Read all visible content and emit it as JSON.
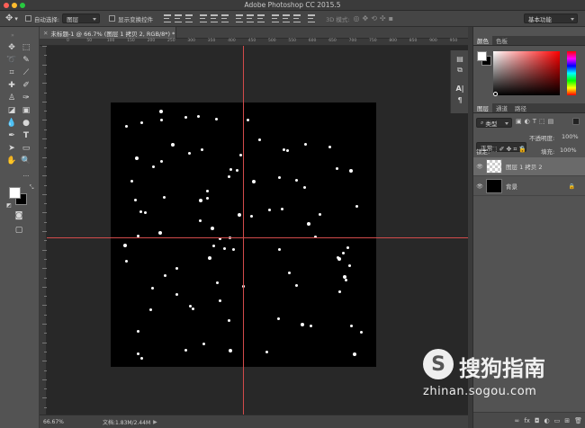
{
  "window": {
    "title": "Adobe Photoshop CC 2015.5"
  },
  "options_bar": {
    "auto_select_label": "自动选择:",
    "auto_select_value": "图层",
    "show_transform_label": "显示变换控件",
    "mode_3d_label": "3D 模式:",
    "workspace_value": "基本功能"
  },
  "document": {
    "tab_label": "未标题-1 @ 66.7% (图层 1 拷贝 2, RGB/8*) *"
  },
  "status": {
    "zoom": "66.67%",
    "doc_size": "文档:1.83M/2.44M"
  },
  "rulers": {
    "h_ticks": [
      "0",
      "50",
      "100",
      "150",
      "200",
      "250",
      "300",
      "350",
      "400",
      "450",
      "500",
      "550",
      "600",
      "650",
      "700",
      "750",
      "800",
      "850",
      "900",
      "950"
    ]
  },
  "panels": {
    "color_tabs": [
      "颜色",
      "色板"
    ],
    "layer_tabs": [
      "图层",
      "通道",
      "路径"
    ],
    "kind_filter": "类型",
    "blend_mode": "正常",
    "opacity_label": "不透明度:",
    "opacity_value": "100%",
    "lock_label": "锁定:",
    "fill_label": "填充:",
    "fill_value": "100%",
    "layers": [
      {
        "name": "图层 1 拷贝 2",
        "selected": true
      },
      {
        "name": "背景",
        "selected": false
      }
    ]
  },
  "colors": {
    "foreground": "#ffffff",
    "background": "#000000",
    "guide": "#d24b4b",
    "picker_hue": "#ff0000"
  },
  "watermark": {
    "brand": "搜狗指南",
    "url": "zhinan.sogou.com"
  }
}
